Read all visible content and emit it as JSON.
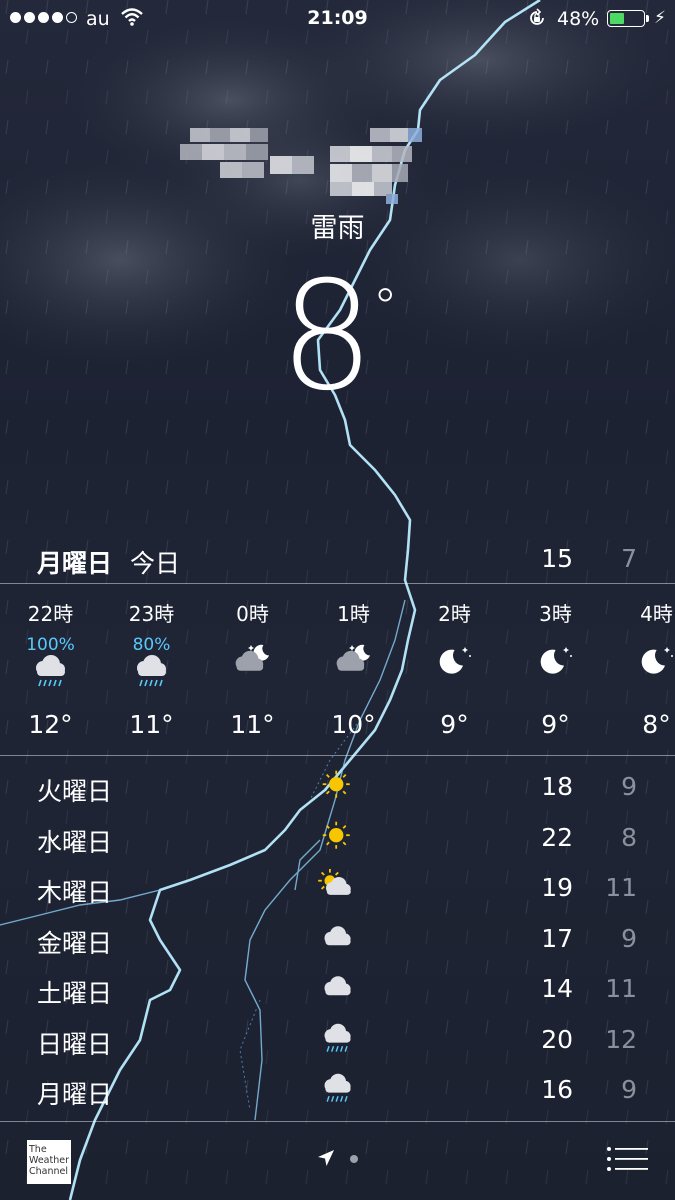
{
  "status_bar": {
    "signal_dots": 5,
    "signal_filled": 4,
    "carrier": "au",
    "time": "21:09",
    "battery_pct_label": "48%",
    "battery_level": 0.48,
    "battery_color": "#4cd964",
    "icons": [
      "wifi-icon",
      "rotation-lock-icon",
      "charging-bolt-icon"
    ]
  },
  "header": {
    "condition": "雷雨",
    "temperature": "8",
    "degree": "°"
  },
  "today": {
    "day": "月曜日",
    "label": "今日",
    "high": "15",
    "low": "7"
  },
  "hourly": [
    {
      "time": "22時",
      "pop": "100%",
      "icon": "rain-cloud-icon",
      "temp": "12°"
    },
    {
      "time": "23時",
      "pop": "80%",
      "icon": "rain-cloud-icon",
      "temp": "11°"
    },
    {
      "time": "0時",
      "pop": "",
      "icon": "cloudy-night-icon",
      "temp": "11°"
    },
    {
      "time": "1時",
      "pop": "",
      "icon": "cloudy-night-icon",
      "temp": "10°"
    },
    {
      "time": "2時",
      "pop": "",
      "icon": "clear-night-icon",
      "temp": "9°"
    },
    {
      "time": "3時",
      "pop": "",
      "icon": "clear-night-icon",
      "temp": "9°"
    },
    {
      "time": "4時",
      "pop": "",
      "icon": "clear-night-icon",
      "temp": "8°"
    }
  ],
  "daily": [
    {
      "day": "火曜日",
      "icon": "sun-icon",
      "high": "18",
      "low": "9"
    },
    {
      "day": "水曜日",
      "icon": "sun-icon",
      "high": "22",
      "low": "8"
    },
    {
      "day": "木曜日",
      "icon": "partly-cloudy-icon",
      "high": "19",
      "low": "11"
    },
    {
      "day": "金曜日",
      "icon": "cloud-icon",
      "high": "17",
      "low": "9"
    },
    {
      "day": "土曜日",
      "icon": "cloud-icon",
      "high": "14",
      "low": "11"
    },
    {
      "day": "日曜日",
      "icon": "rain-cloud-icon",
      "high": "20",
      "low": "12"
    },
    {
      "day": "月曜日",
      "icon": "rain-cloud-icon",
      "high": "16",
      "low": "9"
    }
  ],
  "bottom": {
    "logo_text": [
      "The",
      "Weather",
      "Channel"
    ],
    "icons": [
      "location-arrow-icon",
      "page-dot",
      "list-icon"
    ]
  },
  "colors": {
    "precip_blue": "#5ac8fa",
    "sun_yellow": "#f7c600",
    "low_temp_gray": "#8c909c"
  }
}
